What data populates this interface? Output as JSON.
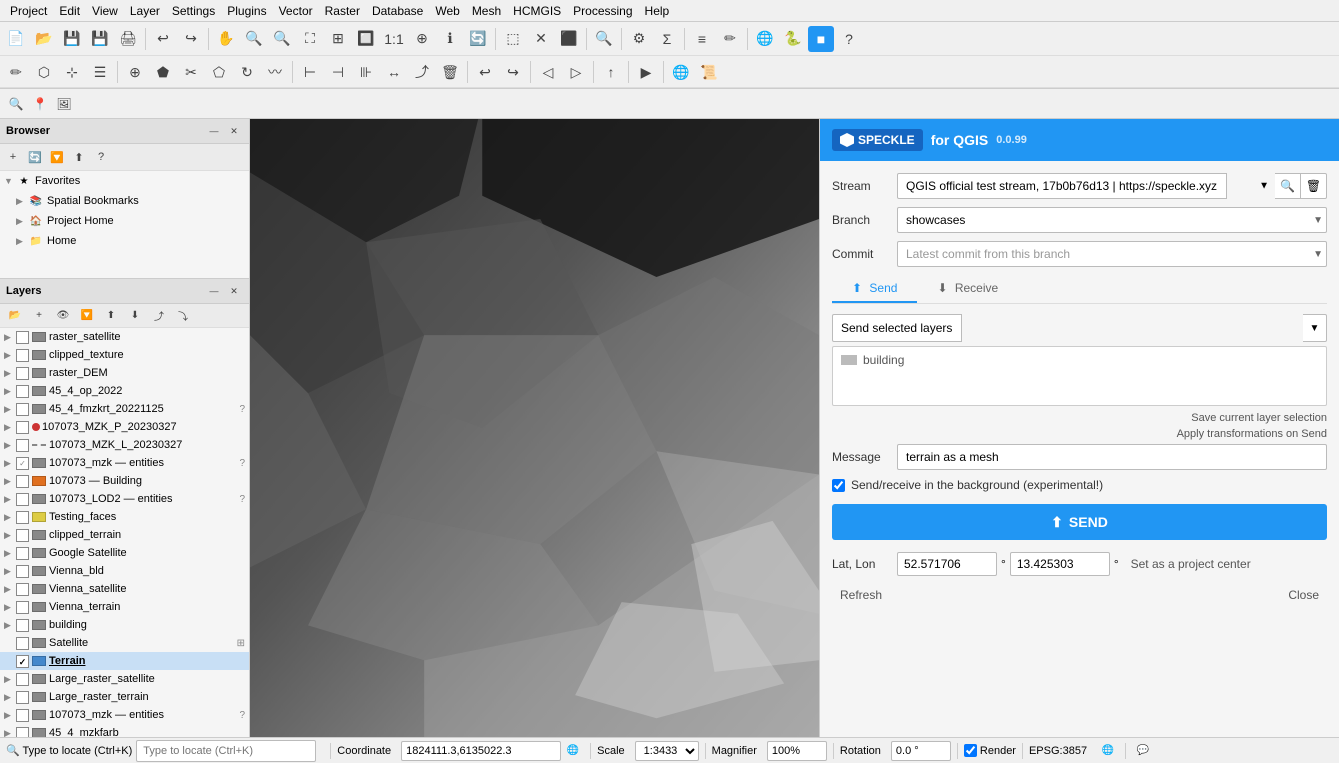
{
  "menubar": {
    "items": [
      "Project",
      "Edit",
      "View",
      "Layer",
      "Settings",
      "Plugins",
      "Vector",
      "Raster",
      "Database",
      "Web",
      "Mesh",
      "HCMGIS",
      "Processing",
      "Help"
    ]
  },
  "browser_panel": {
    "title": "Browser",
    "items": [
      {
        "label": "Favorites",
        "icon": "★",
        "expanded": true
      },
      {
        "label": "Spatial Bookmarks",
        "icon": "📚",
        "indent": true
      },
      {
        "label": "Project Home",
        "icon": "🏠",
        "indent": true
      },
      {
        "label": "Home",
        "icon": "📁",
        "indent": true
      }
    ]
  },
  "layers_panel": {
    "title": "Layers",
    "items": [
      {
        "name": "raster_satellite",
        "type": "raster",
        "checked": false,
        "expanded": false,
        "color": "gray"
      },
      {
        "name": "clipped_texture",
        "type": "raster",
        "checked": false,
        "expanded": false,
        "color": "gray"
      },
      {
        "name": "raster_DEM",
        "type": "raster",
        "checked": false,
        "expanded": false,
        "color": "gray"
      },
      {
        "name": "45_4_op_2022",
        "type": "raster",
        "checked": false,
        "expanded": false,
        "color": "gray"
      },
      {
        "name": "45_4_fmzkrt_20221125",
        "type": "raster",
        "checked": false,
        "expanded": false,
        "color": "gray",
        "help": true
      },
      {
        "name": "107073_MZK_P_20230327",
        "type": "vector",
        "checked": false,
        "expanded": false,
        "color": "red",
        "dot": true
      },
      {
        "name": "107073_MZK_L_20230327",
        "type": "vector",
        "checked": false,
        "expanded": false,
        "color": "gray",
        "dash": true
      },
      {
        "name": "107073_mzk — entities",
        "type": "vector",
        "checked": false,
        "expanded": false,
        "color": "gray",
        "check_partial": true,
        "help": true
      },
      {
        "name": "107073 — Building",
        "type": "vector",
        "checked": false,
        "expanded": false,
        "color": "orange",
        "swatch": true
      },
      {
        "name": "107073_LOD2 — entities",
        "type": "vector",
        "checked": false,
        "expanded": false,
        "color": "gray",
        "help": true
      },
      {
        "name": "Testing_faces",
        "type": "vector",
        "checked": false,
        "expanded": false,
        "color": "yellow",
        "swatch": true
      },
      {
        "name": "clipped_terrain",
        "type": "raster",
        "checked": false,
        "expanded": false,
        "color": "gray"
      },
      {
        "name": "Google Satellite",
        "type": "raster",
        "checked": false,
        "expanded": false,
        "color": "gray"
      },
      {
        "name": "Vienna_bld",
        "type": "raster",
        "checked": false,
        "expanded": false,
        "color": "gray"
      },
      {
        "name": "Vienna_satellite",
        "type": "raster",
        "checked": false,
        "expanded": false,
        "color": "gray"
      },
      {
        "name": "Vienna_terrain",
        "type": "raster",
        "checked": false,
        "expanded": false,
        "color": "gray"
      },
      {
        "name": "building",
        "type": "vector",
        "checked": false,
        "expanded": false,
        "color": "gray"
      },
      {
        "name": "Satellite",
        "type": "raster",
        "checked": false,
        "expanded": false,
        "color": "gray",
        "sub": true
      },
      {
        "name": "Terrain",
        "type": "vector",
        "checked": true,
        "expanded": false,
        "color": "blue",
        "selected": true
      },
      {
        "name": "Large_raster_satellite",
        "type": "raster",
        "checked": false,
        "expanded": false,
        "color": "gray"
      },
      {
        "name": "Large_raster_terrain",
        "type": "raster",
        "checked": false,
        "expanded": false,
        "color": "gray"
      },
      {
        "name": "107073_mzk — entities",
        "type": "vector",
        "checked": false,
        "expanded": false,
        "color": "gray",
        "help": true
      },
      {
        "name": "45_4_mzkfarb",
        "type": "raster",
        "checked": false,
        "expanded": false,
        "color": "gray"
      }
    ]
  },
  "speckle": {
    "title": "for QGIS",
    "version": "0.0.99",
    "stream_label": "Stream",
    "branch_label": "Branch",
    "commit_label": "Commit",
    "stream_value": "QGIS official test stream, 17b0b76d13 | https://speckle.xyz",
    "branch_value": "showcases",
    "commit_placeholder": "Latest commit from this branch",
    "tab_send": "Send",
    "tab_receive": "Receive",
    "send_layers_label": "Send selected layers",
    "layers_box_item": "building",
    "save_layer_selection": "Save current layer selection",
    "apply_transformations": "Apply transformations on Send",
    "message_label": "Message",
    "message_value": "terrain as a mesh",
    "checkbox_label": "Send/receive in the background (experimental!)",
    "checkbox_checked": true,
    "send_btn_label": "SEND",
    "lat_lon_label": "Lat, Lon",
    "lat_value": "52.571706",
    "lon_value": "13.425303",
    "set_center": "Set as a project center",
    "refresh_btn": "Refresh",
    "close_btn": "Close"
  },
  "statusbar": {
    "coordinate_label": "Coordinate",
    "coordinate_value": "1824111.3,6135022.3",
    "scale_label": "Scale",
    "scale_value": "1:3433",
    "magnifier_label": "Magnifier",
    "magnifier_value": "100%",
    "rotation_label": "Rotation",
    "rotation_value": "0.0 °",
    "render_label": "Render",
    "epsg_label": "EPSG:3857"
  }
}
